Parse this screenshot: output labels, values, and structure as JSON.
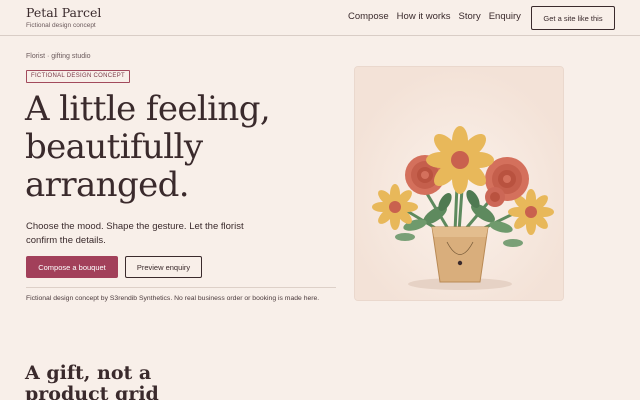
{
  "header": {
    "brand_name": "Petal Parcel",
    "brand_tagline": "Fictional design concept",
    "nav": [
      "Compose",
      "How it works",
      "Story",
      "Enquiry"
    ],
    "cta_label": "Get a site like this"
  },
  "hero": {
    "eyebrow": "Florist · gifting studio",
    "badge": "FICTIONAL DESIGN CONCEPT",
    "headline_line1": "A little feeling,",
    "headline_line2": "beautifully",
    "headline_line3": "arranged.",
    "subtext": "Choose the mood. Shape the gesture. Let the florist confirm the details.",
    "primary_button": "Compose a bouquet",
    "secondary_button": "Preview enquiry",
    "disclaimer": "Fictional design concept by S3rendib Synthetics. No real business order or booking is made here.",
    "illustration": "bouquet-in-kraft-pot-illustration"
  },
  "section": {
    "title": "A gift, not a product grid"
  },
  "colors": {
    "background": "#f8efe9",
    "accent": "#a2405a",
    "text": "#3a2a2c",
    "petal_yellow": "#e8b85a",
    "petal_coral": "#d4705c",
    "leaf_green": "#5e8a5e",
    "pot_kraft": "#d9ae7c"
  }
}
